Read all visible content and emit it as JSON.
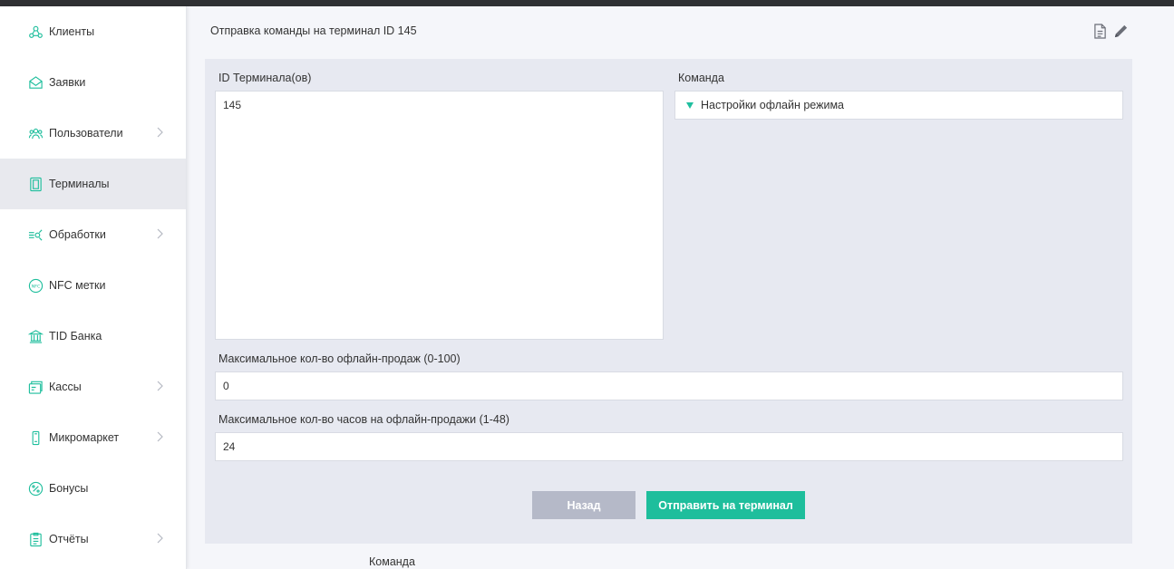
{
  "sidebar": {
    "items": [
      {
        "label": "Клиенты",
        "icon": "clients-icon",
        "chevron": false,
        "active": false
      },
      {
        "label": "Заявки",
        "icon": "envelope-icon",
        "chevron": false,
        "active": false
      },
      {
        "label": "Пользователи",
        "icon": "users-icon",
        "chevron": true,
        "active": false
      },
      {
        "label": "Терминалы",
        "icon": "terminal-icon",
        "chevron": false,
        "active": true
      },
      {
        "label": "Обработки",
        "icon": "processing-icon",
        "chevron": true,
        "active": false
      },
      {
        "label": "NFC метки",
        "icon": "nfc-icon",
        "chevron": false,
        "active": false
      },
      {
        "label": "TID Банка",
        "icon": "bank-icon",
        "chevron": false,
        "active": false
      },
      {
        "label": "Кассы",
        "icon": "cashbox-icon",
        "chevron": true,
        "active": false
      },
      {
        "label": "Микромаркет",
        "icon": "micromarket-icon",
        "chevron": true,
        "active": false
      },
      {
        "label": "Бонусы",
        "icon": "percent-icon",
        "chevron": false,
        "active": false
      },
      {
        "label": "Отчёты",
        "icon": "reports-icon",
        "chevron": true,
        "active": false
      }
    ]
  },
  "header": {
    "title": "Отправка команды на терминал ID 145",
    "icons": [
      "document-icon",
      "pencil-icon"
    ]
  },
  "form": {
    "terminal_ids_label": "ID Терминала(ов)",
    "terminal_ids_value": "145",
    "command_label": "Команда",
    "command_value": "Настройки офлайн режима",
    "max_sales_label": "Максимальное кол-во офлайн-продаж (0-100)",
    "max_sales_value": "0",
    "max_hours_label": "Максимальное кол-во часов на офлайн-продажи (1-48)",
    "max_hours_value": "24",
    "back_label": "Назад",
    "send_label": "Отправить на терминал"
  },
  "footer": {
    "section_label": "Команда"
  },
  "colors": {
    "accent": "#1ebe9c",
    "icon": "#1ebe9c",
    "back_button": "#b5b9c8",
    "panel": "#e7e9f1"
  }
}
